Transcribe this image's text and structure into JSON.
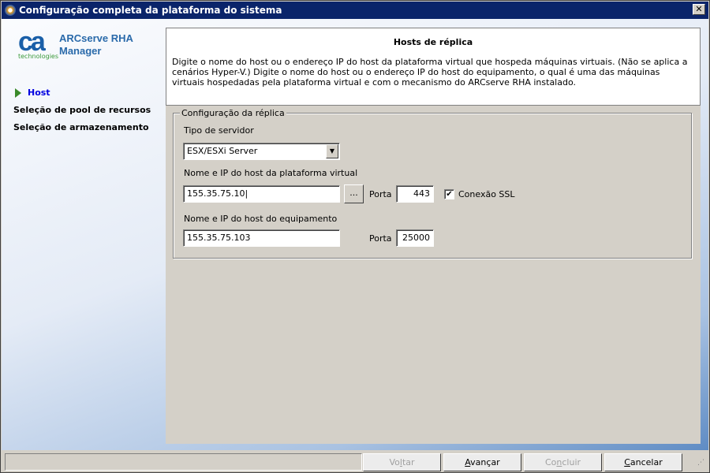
{
  "window": {
    "title": "Configuração completa da plataforma do sistema",
    "close": "✕"
  },
  "logo": {
    "mark": "ca",
    "sub": "technologies",
    "product_line1": "ARCserve RHA",
    "product_line2": "Manager"
  },
  "steps": [
    {
      "label": "Host",
      "active": true
    },
    {
      "label": "Seleção de pool de recursos"
    },
    {
      "label": "Seleção de armazenamento"
    }
  ],
  "header": {
    "title": "Hosts de réplica",
    "description": "Digite o nome do host ou o endereço IP do host da plataforma virtual que hospeda máquinas virtuais. (Não se aplica a cenários Hyper-V.) Digite o nome do host ou o endereço IP do host do equipamento, o qual é uma das máquinas virtuais hospedadas pela plataforma virtual e com o mecanismo do ARCserve RHA instalado."
  },
  "group": {
    "title": "Configuração da réplica",
    "server_type_label": "Tipo de servidor",
    "server_type_value": "ESX/ESXi Server",
    "virtual_host_label": "Nome e IP do host da plataforma virtual",
    "virtual_host_value": "155.35.75.10",
    "browse": "...",
    "port_label": "Porta",
    "virtual_port": "443",
    "ssl_label": "Conexão SSL",
    "ssl_checked": true,
    "appliance_label": "Nome e IP do host do equipamento",
    "appliance_value": "155.35.75.103",
    "appliance_port": "25000"
  },
  "footer": {
    "back_pre": "Vo",
    "back_u": "l",
    "back_post": "tar",
    "next_pre": "",
    "next_u": "A",
    "next_post": "vançar",
    "finish_pre": "Co",
    "finish_u": "n",
    "finish_post": "cluir",
    "cancel_pre": "",
    "cancel_u": "C",
    "cancel_post": "ancelar"
  }
}
